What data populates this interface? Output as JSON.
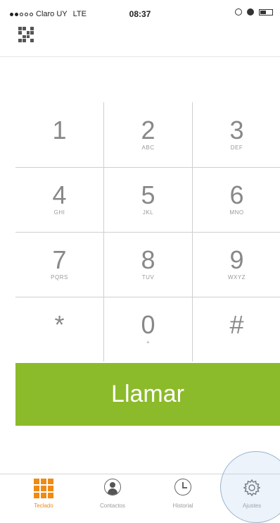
{
  "status_bar": {
    "carrier": "Claro UY",
    "network": "LTE",
    "time": "08:37",
    "signal_bars_filled": 2,
    "signal_bars_total": 5
  },
  "keypad": {
    "keys": [
      {
        "digit": "1",
        "letters": ""
      },
      {
        "digit": "2",
        "letters": "ABC"
      },
      {
        "digit": "3",
        "letters": "DEF"
      },
      {
        "digit": "4",
        "letters": "GHI"
      },
      {
        "digit": "5",
        "letters": "JKL"
      },
      {
        "digit": "6",
        "letters": "MNO"
      },
      {
        "digit": "7",
        "letters": "PQRS"
      },
      {
        "digit": "8",
        "letters": "TUV"
      },
      {
        "digit": "9",
        "letters": "WXYZ"
      },
      {
        "digit": "*",
        "letters": ""
      },
      {
        "digit": "0",
        "letters": "+"
      },
      {
        "digit": "#",
        "letters": ""
      }
    ]
  },
  "call_button": {
    "label": "Llamar",
    "color": "#8bbb2a"
  },
  "tabs": [
    {
      "label": "Teclado",
      "icon": "keypad-grid-icon",
      "active": true
    },
    {
      "label": "Contactos",
      "icon": "contact-person-icon",
      "active": false
    },
    {
      "label": "Historial",
      "icon": "clock-icon",
      "active": false
    },
    {
      "label": "Ajustes",
      "icon": "gear-icon",
      "active": false
    }
  ],
  "colors": {
    "accent": "#f08a14",
    "call": "#8bbb2a"
  }
}
